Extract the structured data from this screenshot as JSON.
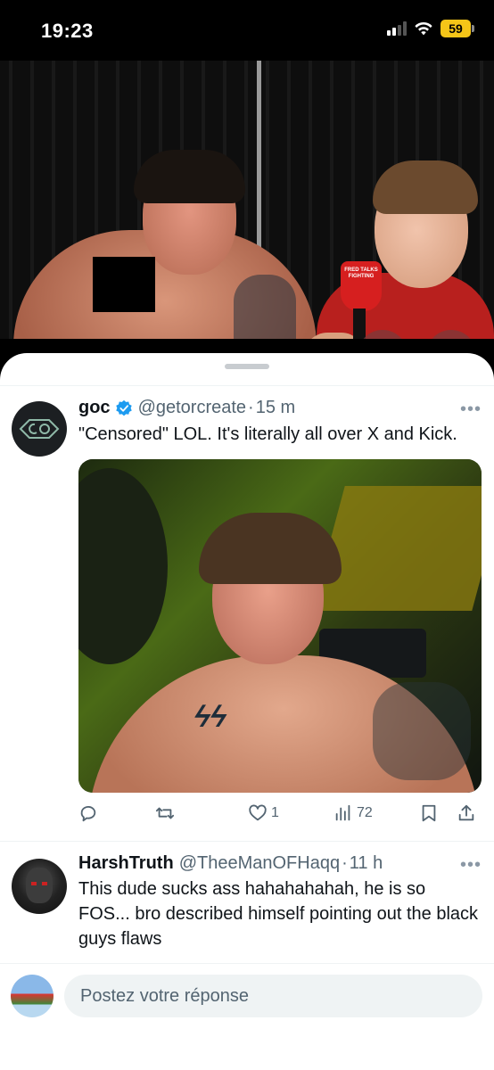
{
  "status_bar": {
    "time": "19:23",
    "battery": "59"
  },
  "video": {
    "mic_label": "FRED TALKS FIGHTING"
  },
  "tweets": [
    {
      "name": "goc",
      "verified": true,
      "handle": "@getorcreate",
      "time": "15 m",
      "text": "\"Censored\" LOL. It's literally all over X and Kick.",
      "actions": {
        "likes": "1",
        "views": "72"
      }
    },
    {
      "name": "HarshTruth",
      "verified": false,
      "handle": "@TheeManOFHaqq",
      "time": "11 h",
      "text": "This dude sucks ass hahahahahah, he is so FOS... bro described himself pointing out the black guys flaws"
    }
  ],
  "reply": {
    "placeholder": "Postez votre réponse"
  },
  "colors": {
    "accent": "#1d9bf0",
    "secondary_text": "#536471",
    "battery": "#f5c518"
  },
  "icons": [
    "wifi-icon",
    "signal-icon",
    "battery-icon",
    "pause-icon",
    "volume-icon",
    "verified-badge-icon",
    "more-icon",
    "reply-icon",
    "retweet-icon",
    "like-icon",
    "views-icon",
    "bookmark-icon",
    "share-icon"
  ]
}
